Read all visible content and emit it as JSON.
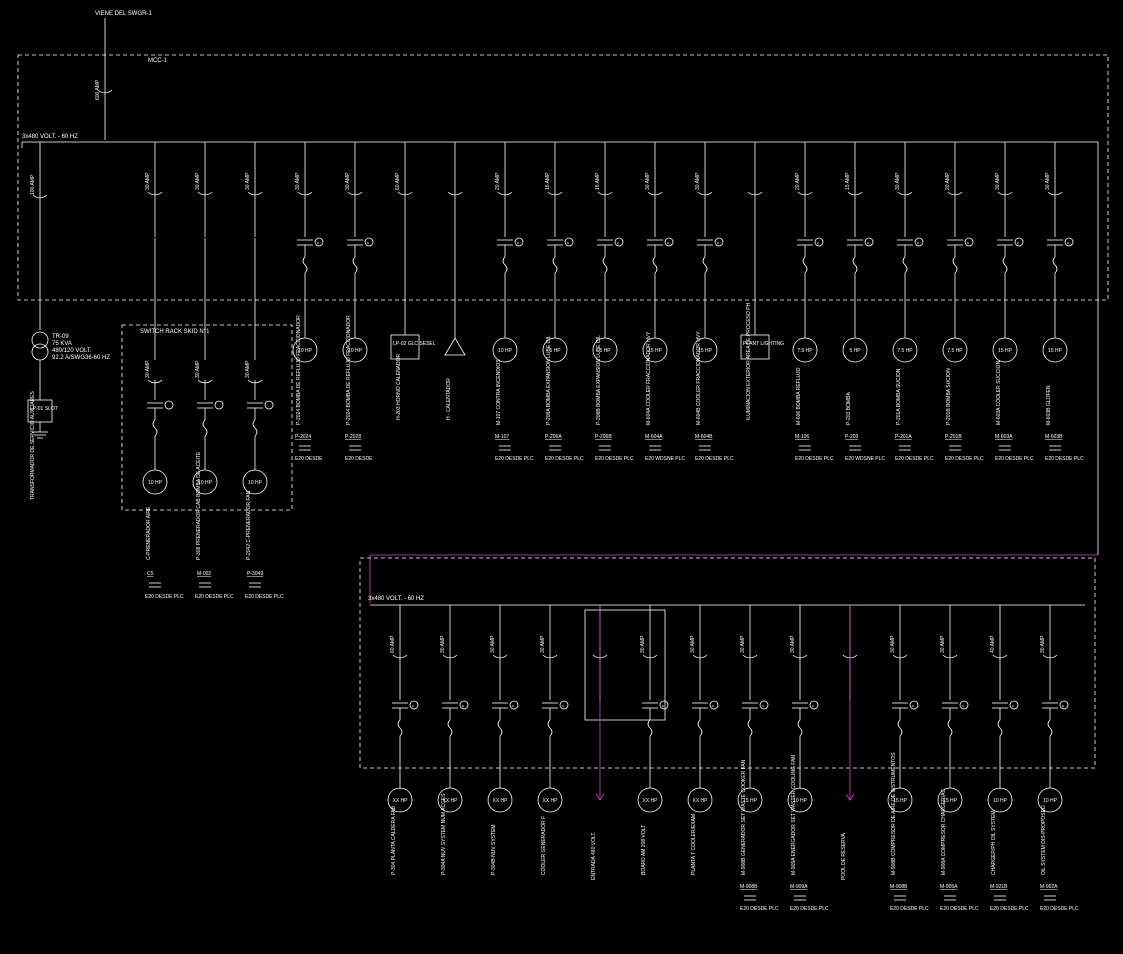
{
  "header": {
    "source": "VIENE DEL SWGR-1",
    "mcc": "MCC-1",
    "mainAmp": "600 AMP",
    "bus1": "3x480 VOLT. - 60 HZ",
    "bus2": "3x480 VOLT. - 60 HZ"
  },
  "transformer": {
    "amp": "100 AMP",
    "tag": "TR-09",
    "rating1": "75 KVA",
    "rating2": "480/120 VOLT.",
    "rating3": "92.2 A/SWG36-60 HZ",
    "panel": "LP-01 SLOT",
    "desc": "TRANSFORMADOR DE SERVICIO AUXLIARES"
  },
  "switchRack": {
    "title": "SWITCH RACK SKID N°1",
    "items": [
      {
        "amp": "30 AMP",
        "hp": "10 HP",
        "desc": "C-PRENERADOR AIRE",
        "tag": "C5",
        "ctrl": "E20 DESDE PLC"
      },
      {
        "amp": "30 AMP",
        "hp": "10 HP",
        "desc": "P-308 PRENERADOR CAB BOMBA DE ACEITE",
        "tag": "M-002",
        "ctrl": "E20 DESDE PLC"
      },
      {
        "amp": "30 AMP",
        "hp": "10 HP",
        "desc": "P-2042 C-PRENERADOR FAN",
        "tag": "P-3049",
        "ctrl": "E20 DESDE PLC"
      }
    ]
  },
  "row1": [
    {
      "amp": "30 AMP",
      "type": "spare"
    },
    {
      "amp": "30 AMP",
      "type": "spare"
    },
    {
      "amp": "30 AMP",
      "type": "spare"
    },
    {
      "amp": "30 AMP",
      "type": "motor",
      "hp": "10 HP",
      "desc": "P-2024 BOMBA DE REFLUJO FRACCIONADOR",
      "tag": "P-2024",
      "ctrl": "E20 DESDE"
    },
    {
      "amp": "30 AMP",
      "type": "motor",
      "hp": "10 HP",
      "desc": "P-2024 BOMBA DE REFLUJO FRACCIONADOR",
      "tag": "P-2028",
      "ctrl": "E20 DESDE"
    },
    {
      "amp": "60 AMP",
      "type": "panel",
      "panel": "LP-02 GLC SESEL",
      "desc": "H-203 HORNO CALENADOR"
    },
    {
      "amp": "",
      "type": "tri",
      "desc": "H - CALENTADOR"
    },
    {
      "amp": "20 AMP",
      "type": "motor",
      "hp": "10 HP",
      "desc": "M-107 CONTRA INCENDIOS",
      "tag": "M-107",
      "ctrl": "E20 DESDE PLC"
    },
    {
      "amp": "15 AMP",
      "type": "motor",
      "hp": "5 HP",
      "desc": "P-208A BOMBA EXPANSION LUBE OIL",
      "tag": "P-206A",
      "ctrl": "E20 DESDE PLC"
    },
    {
      "amp": "15 AMP",
      "type": "motor",
      "hp": "5 HP",
      "desc": "P-208B BOMBA EXPANSION LUBE OIL",
      "tag": "P-206B",
      "ctrl": "E20 DESDE PLC"
    },
    {
      "amp": "30 AMP",
      "type": "motor",
      "hp": "15 HP",
      "desc": "M-604A COOLER FRACCIONADOR HVY",
      "tag": "M-604A",
      "ctrl": "E20 WDSNE PLC"
    },
    {
      "amp": "30 AMP",
      "type": "motor",
      "hp": "15 HP",
      "desc": "M-604B COOLER FRACCIONADOR HVY",
      "tag": "M-604B",
      "ctrl": "E20 DESDE PLC"
    },
    {
      "amp": "",
      "type": "panel",
      "panel": "PLANT LIGHTING",
      "desc": "ILUMINACION EXTERIOR AREA DE PROCESO PH"
    },
    {
      "amp": "20 AMP",
      "type": "motor",
      "hp": "7.5 HP",
      "desc": "M-606 BOMBA REFLUJO",
      "tag": "M-106",
      "ctrl": "E20 DESDE PLC"
    },
    {
      "amp": "15 AMP",
      "type": "motor",
      "hp": "5 HP",
      "desc": "P-203 BOMBA",
      "tag": "P-203",
      "ctrl": "E20 WDSNE PLC"
    },
    {
      "amp": "30 AMP",
      "type": "motor",
      "hp": "7.5 HP",
      "desc": "P-201A BOMBA SUCION",
      "tag": "P-201A",
      "ctrl": "E20 DESDE PLC"
    },
    {
      "amp": "20 AMP",
      "type": "motor",
      "hp": "7.5 HP",
      "desc": "P-201B BOMBA SUCION",
      "tag": "P-201B",
      "ctrl": "E20 DESDE PLC"
    },
    {
      "amp": "30 AMP",
      "type": "motor",
      "hp": "15 HP",
      "desc": "M-603A COOLER SUCCION",
      "tag": "M-603A",
      "ctrl": "E20 DESDE PLC"
    },
    {
      "amp": "30 AMP",
      "type": "motor",
      "hp": "15 HP",
      "desc": "M-603B GLOFEN",
      "tag": "M-603B",
      "ctrl": "E20 DESDE PLC"
    }
  ],
  "row2": [
    {
      "amp": "60 AMP",
      "type": "motor",
      "hp": "XX HP",
      "desc": "P-304 PLANTA CALDERA FAB"
    },
    {
      "amp": "30 AMP",
      "type": "motor",
      "hp": "XX HP",
      "desc": "P-304A NUV SYSTEM NUM ACCES"
    },
    {
      "amp": "30 AMP",
      "type": "motor",
      "hp": "XX HP",
      "desc": "P-304B NUV SYSTEM"
    },
    {
      "amp": "30 AMP",
      "type": "motor",
      "hp": "XX HP",
      "desc": "COOLER GENERADOR F"
    },
    {
      "amp": "",
      "type": "arrow",
      "desc": "ENTRADA 480 VOLT."
    },
    {
      "amp": "30 AMP",
      "type": "motor",
      "hp": "XX HP",
      "desc": "BOARD AM 208 VOLT"
    },
    {
      "amp": "30 AMP",
      "type": "motor",
      "hp": "XX HP",
      "desc": "PLANTA T COOLER/EXAM"
    },
    {
      "amp": "30 AMP",
      "type": "motor",
      "hp": "15 HP",
      "desc": "M-908B GENERADOR SET WASTE COOKER FAN",
      "tag": "M-908B",
      "ctrl": "E20 DESDE PLC"
    },
    {
      "amp": "30 AMP",
      "type": "motor",
      "hp": "10 HP",
      "desc": "M-909A ENERGADOR SET WASTER COOLING FAN",
      "tag": "M-909A",
      "ctrl": "E20 DESDE PLC"
    },
    {
      "amp": "",
      "type": "arrow2",
      "desc": "POOL DE RESERVA"
    },
    {
      "amp": "30 AMP",
      "type": "motor",
      "hp": "15 HP",
      "desc": "M-908B COMPRESOR DE AIRE DE INSTRUMENTOS",
      "tag": "M-908B",
      "ctrl": "E20 DESDE PLC"
    },
    {
      "amp": "30 AMP",
      "type": "motor",
      "hp": "15 HP",
      "desc": "M-908A COMPRESOR CHARGER/AC",
      "tag": "M-905A",
      "ctrl": "E20 DESDE PLC"
    },
    {
      "amp": "40 AMP",
      "type": "motor",
      "hp": "10 HP",
      "desc": "CHARGER/PH OIL SYSTEM",
      "tag": "M-921B",
      "ctrl": "E20 DESDE PLC"
    },
    {
      "amp": "30 AMP",
      "type": "motor",
      "hp": "10 HP",
      "desc": "OIL SYSTEM DIS-PROPOSED",
      "tag": "M-902A",
      "ctrl": "E20 DESDE PLC"
    }
  ]
}
